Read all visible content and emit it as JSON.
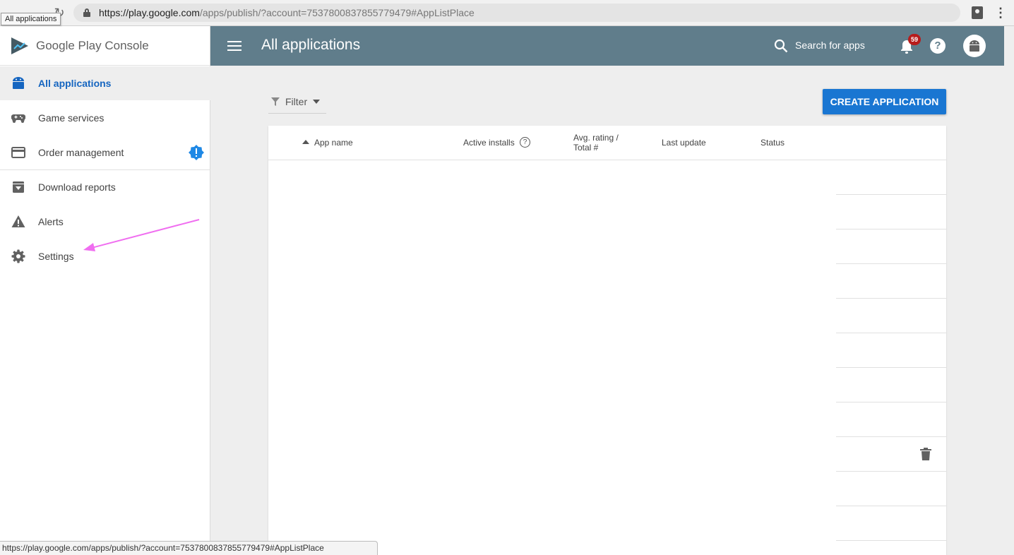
{
  "browser": {
    "url_host": "https://play.google.com",
    "url_path": "/apps/publish/?account=7537800837855779479#AppListPlace",
    "tooltip": "All applications",
    "status_url": "https://play.google.com/apps/publish/?account=7537800837855779479#AppListPlace"
  },
  "brand": {
    "name": "Google Play Console"
  },
  "sidebar": {
    "items": [
      {
        "label": "All applications",
        "icon": "android-icon",
        "active": true
      },
      {
        "label": "Game services",
        "icon": "gamepad-icon"
      },
      {
        "label": "Order management",
        "icon": "credit-card-icon",
        "badge_icon": "alert-badge-icon"
      },
      {
        "label": "Download reports",
        "icon": "download-box-icon"
      },
      {
        "label": "Alerts",
        "icon": "warning-icon"
      },
      {
        "label": "Settings",
        "icon": "gear-icon"
      }
    ]
  },
  "header": {
    "title": "All applications",
    "search_label": "Search for apps",
    "notification_count": "59",
    "help_label": "?"
  },
  "toolbar": {
    "filter_label": "Filter",
    "create_label": "CREATE APPLICATION"
  },
  "table": {
    "columns": [
      "App name",
      "Active installs",
      "Avg. rating /",
      "Total #",
      "Last update",
      "Status"
    ]
  },
  "colors": {
    "header_bg": "#607d8b",
    "primary_button": "#1976d2",
    "active_nav": "#1565c0",
    "annotation_arrow": "#f06ef0"
  }
}
